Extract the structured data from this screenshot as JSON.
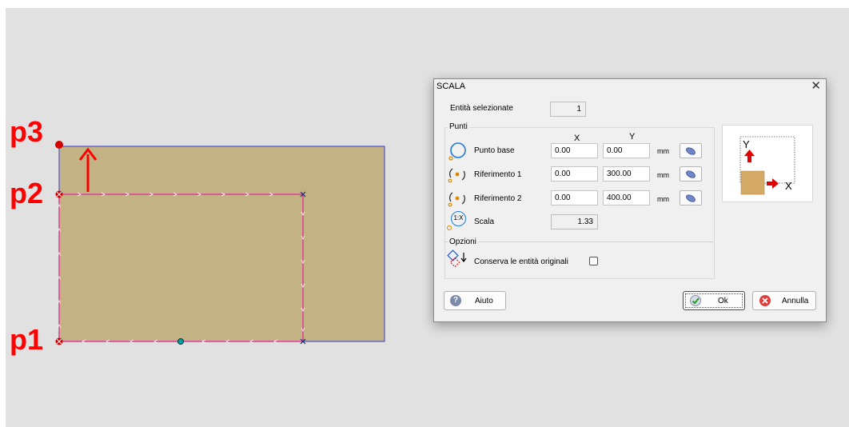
{
  "drawing": {
    "points": [
      "p1",
      "p2",
      "p3"
    ]
  },
  "dialog": {
    "title": "SCALA",
    "close_glyph": "✕",
    "selected_label": "Entità selezionate",
    "selected_count": "1",
    "points_group_label": "Punti",
    "col_x": "X",
    "col_y": "Y",
    "rows": [
      {
        "label": "Punto base",
        "x": "0.00",
        "y": "0.00",
        "unit": "mm"
      },
      {
        "label": "Riferimento 1",
        "x": "0.00",
        "y": "300.00",
        "unit": "mm"
      },
      {
        "label": "Riferimento 2",
        "x": "0.00",
        "y": "400.00",
        "unit": "mm"
      }
    ],
    "scale_label": "Scala",
    "scale_value": "1.33",
    "scale_icon_text": "1:X",
    "options_group_label": "Opzioni",
    "keep_originals_label": "Conserva le entità originali",
    "keep_originals_checked": false,
    "preview_axis_y": "Y",
    "preview_axis_x": "X",
    "buttons": {
      "help": "Aiuto",
      "ok": "Ok",
      "cancel": "Annulla"
    }
  },
  "colors": {
    "canvas_bg": "#e1e1e1",
    "panel_fill": "#c2b284",
    "panel_outline": "#3c3cd2",
    "profile_line": "#e0409a",
    "point_label": "#ff0000"
  }
}
